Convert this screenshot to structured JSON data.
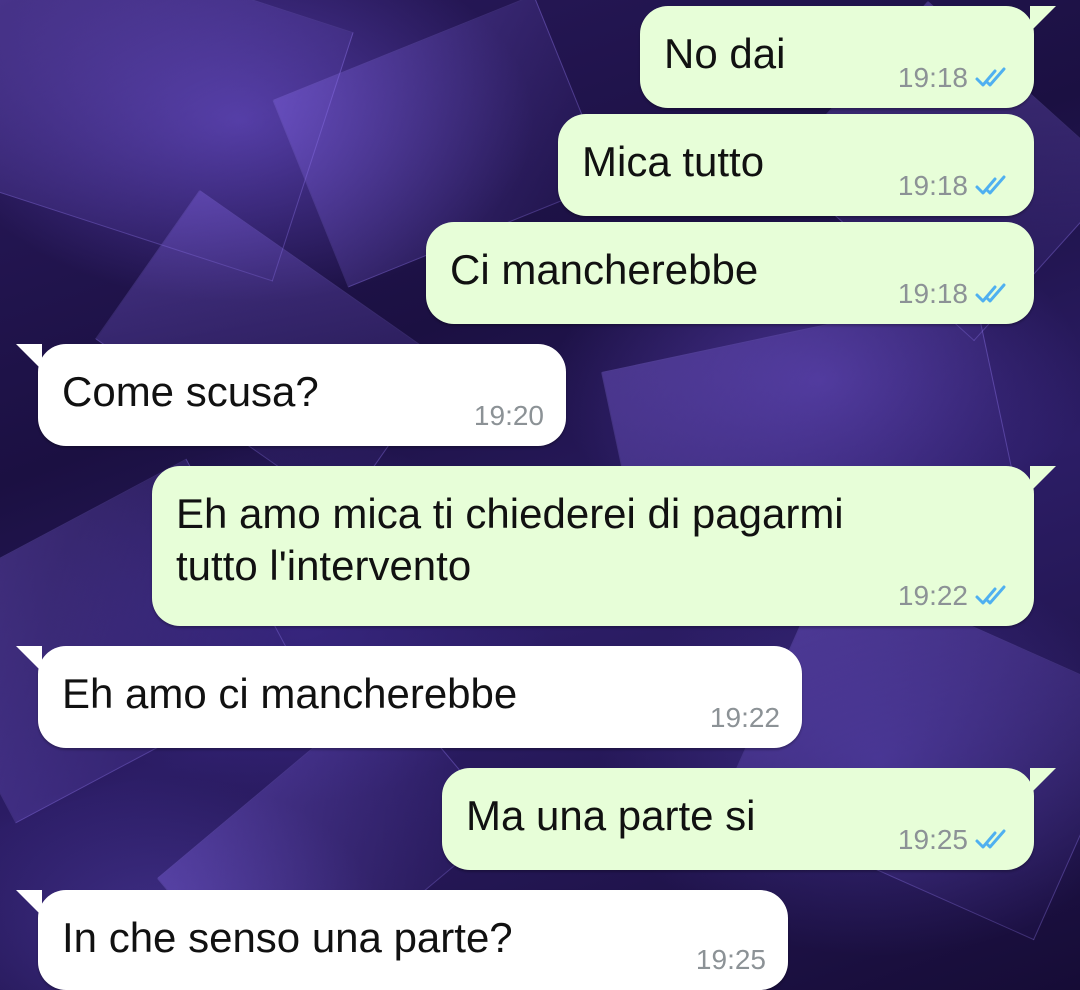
{
  "colors": {
    "outgoing_bubble": "#e7fed8",
    "incoming_bubble": "#ffffff",
    "read_ticks": "#4fb0f0",
    "time_text": "#8c9296"
  },
  "messages": [
    {
      "direction": "outgoing",
      "text": "No dai",
      "time": "19:18",
      "status": "read-double-check-icon"
    },
    {
      "direction": "outgoing",
      "text": "Mica tutto",
      "time": "19:18",
      "status": "read-double-check-icon"
    },
    {
      "direction": "outgoing",
      "text": "Ci mancherebbe",
      "time": "19:18",
      "status": "read-double-check-icon"
    },
    {
      "direction": "incoming",
      "text": "Come scusa?",
      "time": "19:20"
    },
    {
      "direction": "outgoing",
      "text": "Eh amo mica ti chiederei di pagarmi\ntutto l'intervento",
      "time": "19:22",
      "status": "read-double-check-icon"
    },
    {
      "direction": "incoming",
      "text": "Eh amo ci mancherebbe",
      "time": "19:22"
    },
    {
      "direction": "outgoing",
      "text": "Ma una parte si",
      "time": "19:25",
      "status": "read-double-check-icon"
    },
    {
      "direction": "incoming",
      "text": "In che senso una parte?",
      "time": "19:25"
    }
  ]
}
